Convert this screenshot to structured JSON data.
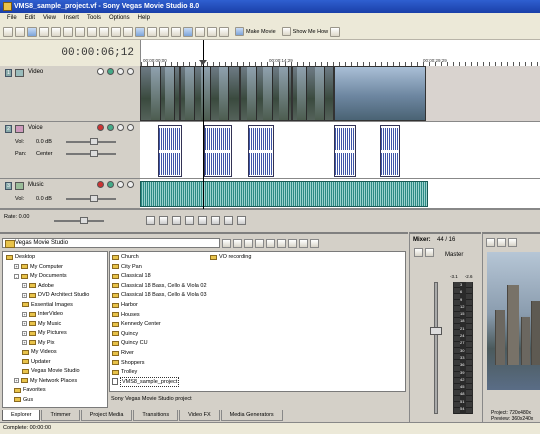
{
  "window": {
    "title": "VMS8_sample_project.vf - Sony Vegas Movie Studio 8.0"
  },
  "menu": [
    "File",
    "Edit",
    "View",
    "Insert",
    "Tools",
    "Options",
    "Help"
  ],
  "toolbar": {
    "make_movie_label": "Make Movie",
    "show_me_how_label": "Show Me How"
  },
  "timeline": {
    "timecode": "00:00:06;12",
    "ruler_labels": [
      "00:00:00;00",
      "00:00:14;29",
      "00:00:29;29"
    ],
    "tracks": [
      {
        "number": "1",
        "name": "Video",
        "type": "video"
      },
      {
        "number": "2",
        "name": "Voice",
        "type": "audio",
        "vol_label": "Vol:",
        "vol_value": "0.0 dB",
        "pan_label": "Pan:",
        "pan_value": "Center"
      },
      {
        "number": "3",
        "name": "Music",
        "type": "audio",
        "vol_label": "Vol:",
        "vol_value": "0.0 dB"
      }
    ],
    "rate_label": "Rate: 0.00"
  },
  "explorer": {
    "path": "Vegas Movie Studio",
    "tree": [
      {
        "label": "Desktop",
        "level": 0,
        "expander": ""
      },
      {
        "label": "My Computer",
        "level": 1,
        "expander": "+"
      },
      {
        "label": "My Documents",
        "level": 1,
        "expander": "-"
      },
      {
        "label": "Adobe",
        "level": 2,
        "expander": "+"
      },
      {
        "label": "DVD Architect Studio",
        "level": 2,
        "expander": "+"
      },
      {
        "label": "Essential Images",
        "level": 2,
        "expander": ""
      },
      {
        "label": "InterVideo",
        "level": 2,
        "expander": "+"
      },
      {
        "label": "My Music",
        "level": 2,
        "expander": "+"
      },
      {
        "label": "My Pictures",
        "level": 2,
        "expander": "+"
      },
      {
        "label": "My Pix",
        "level": 2,
        "expander": "+"
      },
      {
        "label": "My Videos",
        "level": 2,
        "expander": ""
      },
      {
        "label": "Updater",
        "level": 2,
        "expander": ""
      },
      {
        "label": "Vegas Movie Studio",
        "level": 2,
        "expander": ""
      },
      {
        "label": "My Network Places",
        "level": 1,
        "expander": "+"
      },
      {
        "label": "Favorites",
        "level": 1,
        "expander": ""
      },
      {
        "label": "Gus",
        "level": 1,
        "expander": ""
      }
    ],
    "files_col1": [
      {
        "label": "Church",
        "kind": "folder"
      },
      {
        "label": "City Pan",
        "kind": "folder"
      },
      {
        "label": "Classical 18",
        "kind": "folder"
      },
      {
        "label": "Classical 18 Bass, Cello & Viola 02",
        "kind": "folder"
      },
      {
        "label": "Classical 18 Bass, Cello & Viola 03",
        "kind": "folder"
      },
      {
        "label": "Harbor",
        "kind": "folder"
      },
      {
        "label": "Houses",
        "kind": "folder"
      },
      {
        "label": "Kennedy Center",
        "kind": "folder"
      },
      {
        "label": "Quincy",
        "kind": "folder"
      },
      {
        "label": "Quincy CU",
        "kind": "folder"
      },
      {
        "label": "River",
        "kind": "folder"
      },
      {
        "label": "Shoppers",
        "kind": "folder"
      },
      {
        "label": "Trolley",
        "kind": "folder"
      },
      {
        "label": "VMS8_sample_project",
        "kind": "project"
      }
    ],
    "files_col2": [
      {
        "label": "VO recording",
        "kind": "folder"
      }
    ],
    "description": "Sony Vegas Movie Studio project",
    "tabs": [
      "Explorer",
      "Trimmer",
      "Project Media",
      "Transitions",
      "Video FX",
      "Media Generators"
    ]
  },
  "mixer": {
    "title": "Mixer:",
    "count": "44 / 16",
    "master_label": "Master",
    "peak_left": "-3.1",
    "peak_right": "-2.6",
    "scale": [
      "3",
      "6",
      "9",
      "12",
      "15",
      "18",
      "21",
      "24",
      "27",
      "30",
      "33",
      "36",
      "39",
      "42",
      "45",
      "48",
      "51",
      "54"
    ]
  },
  "preview": {
    "project_label": "Project:",
    "project_value": "720x480x",
    "preview_label": "Preview:",
    "preview_value": "360x240x"
  },
  "status": {
    "text": "Complete: 00:00:00"
  }
}
